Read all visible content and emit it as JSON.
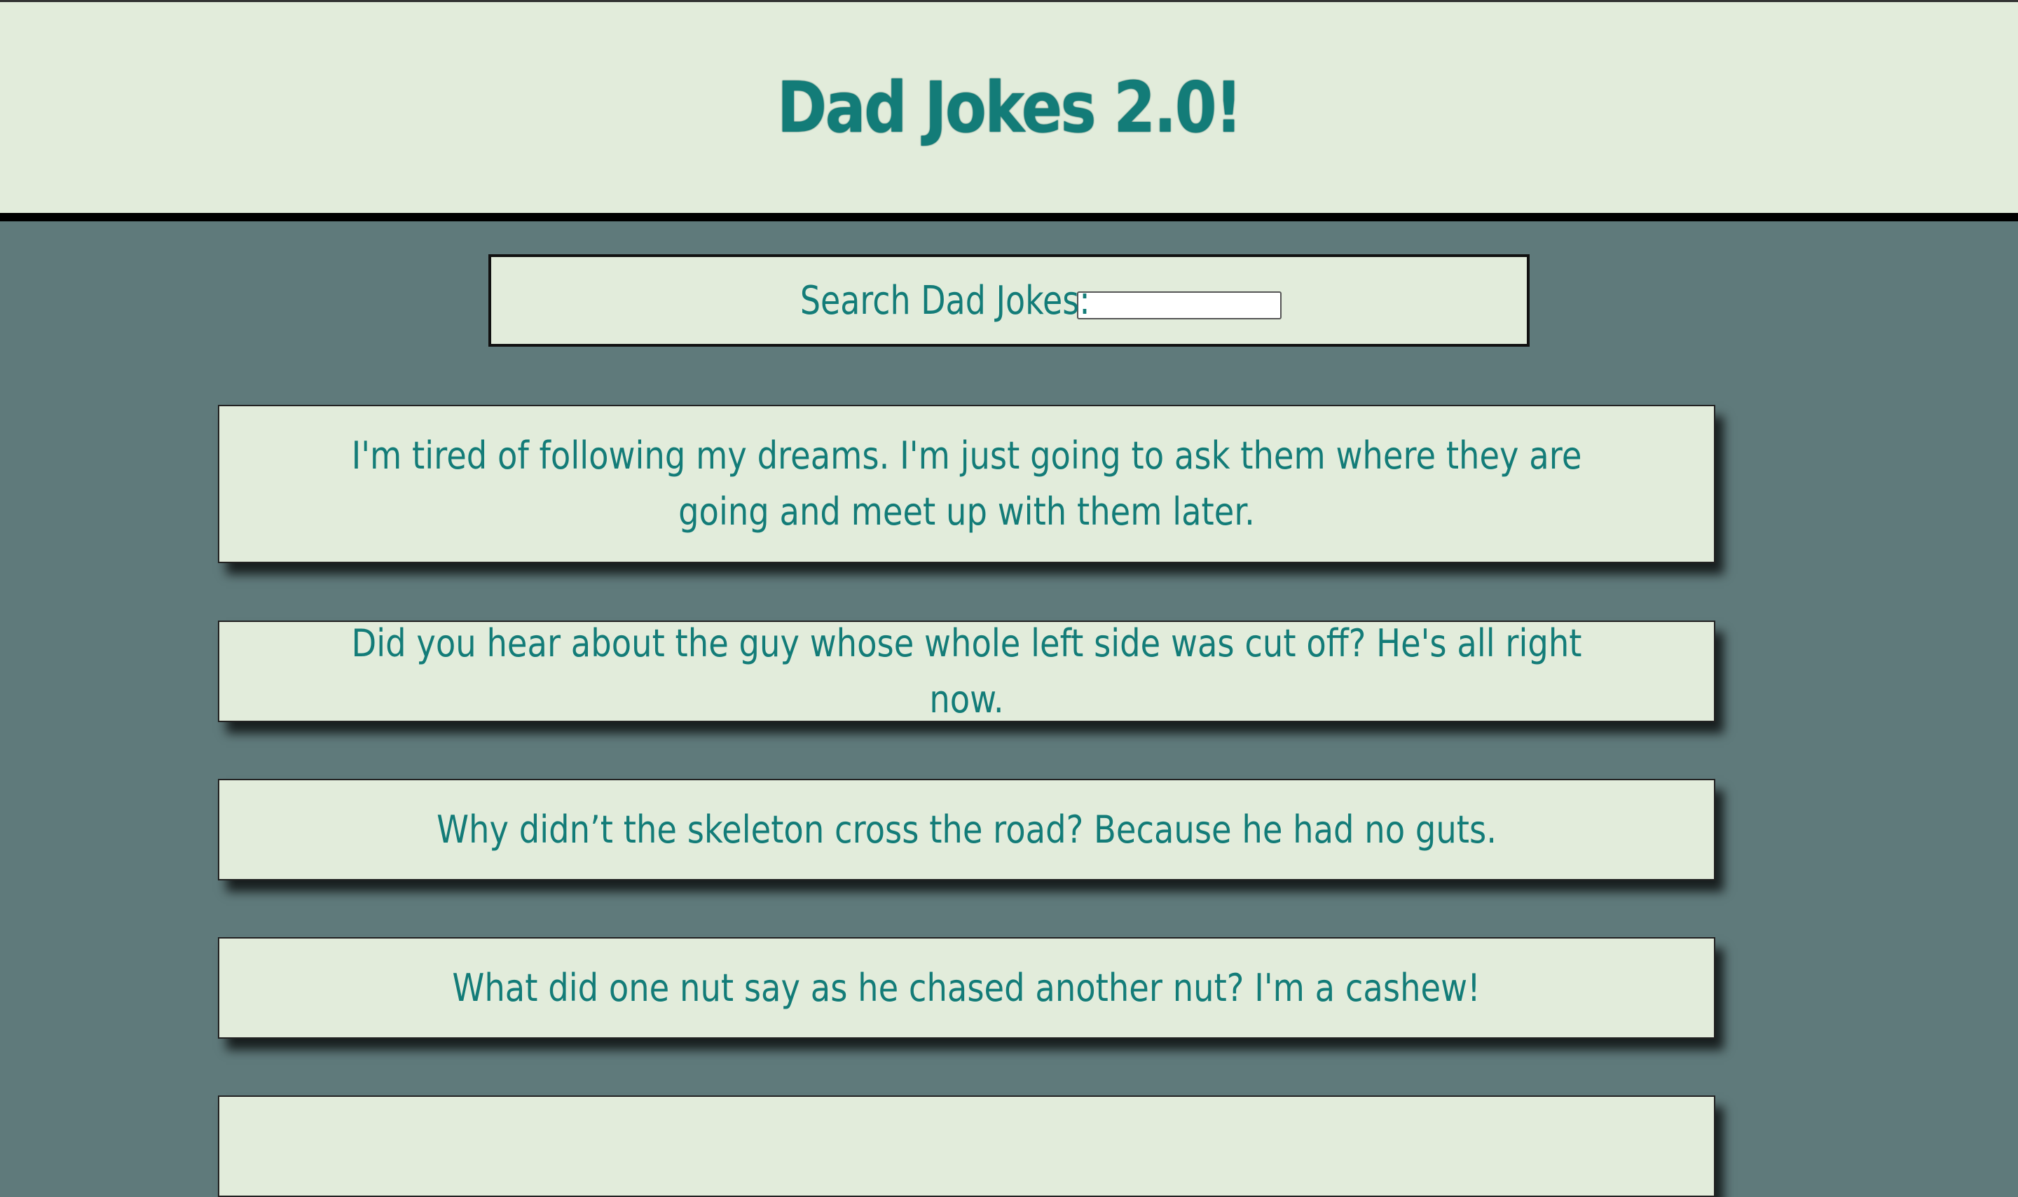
{
  "header": {
    "title": "Dad Jokes 2.0!"
  },
  "search": {
    "label": "Search Dad Jokes:",
    "value": "",
    "placeholder": ""
  },
  "jokes": [
    "I'm tired of following my dreams. I'm just going to ask them where they are going and meet up with them later.",
    "Did you hear about the guy whose whole left side was cut off? He's all right now.",
    "Why didn’t the skeleton cross the road? Because he had no guts.",
    "What did one nut say as he chased another nut? I'm a cashew!",
    ""
  ],
  "colors": {
    "page_background": "#5f7a7b",
    "card_background": "#e2ecdb",
    "text": "#137c78",
    "border": "#000000"
  }
}
